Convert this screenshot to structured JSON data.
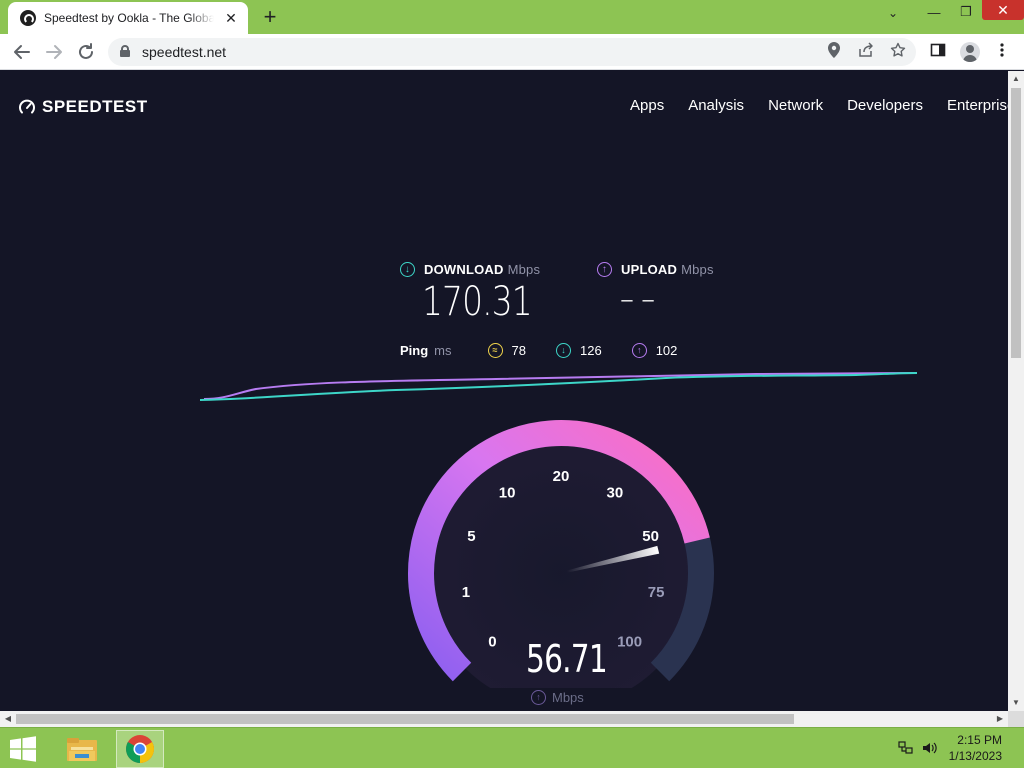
{
  "browser": {
    "tab_title": "Speedtest by Ookla - The Global Broadband Speed Test",
    "tab_close": "✕",
    "new_tab": "+",
    "url": "speedtest.net",
    "window_controls": {
      "minimize": "—",
      "restore": "❐",
      "close": "✕",
      "tab_search": "⌄"
    }
  },
  "page": {
    "logo": "SPEEDTEST",
    "nav": [
      "Apps",
      "Analysis",
      "Network",
      "Developers",
      "Enterprise"
    ],
    "download": {
      "label": "DOWNLOAD",
      "unit": "Mbps",
      "value": "170.31",
      "color": "#3dd6c8"
    },
    "upload": {
      "label": "UPLOAD",
      "unit": "Mbps",
      "value": "– –",
      "color": "#b77cf2"
    },
    "ping": {
      "label": "Ping",
      "unit": "ms",
      "idle": "78",
      "download": "126",
      "upload": "102"
    },
    "gauge": {
      "ticks": [
        "0",
        "1",
        "5",
        "10",
        "20",
        "30",
        "50",
        "75",
        "100"
      ],
      "current_speed": "56.71",
      "unit": "Mbps",
      "needle_value_mbps": 56.71,
      "colors": {
        "arc_start": "#8c5ff0",
        "arc_end": "#ff6dbf",
        "track": "#2a3350"
      }
    }
  },
  "taskbar": {
    "time": "2:15 PM",
    "date": "1/13/2023"
  }
}
